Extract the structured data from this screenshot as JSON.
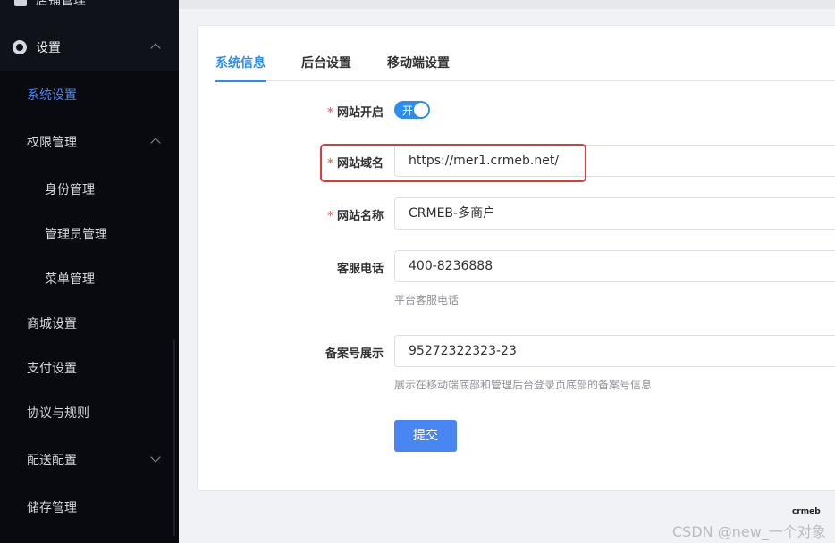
{
  "sidebar": {
    "top_item": "店铺管理",
    "parent": {
      "label": "设置",
      "icon": "gear-icon"
    },
    "items": [
      {
        "label": "系统设置",
        "active": true,
        "level": 2
      },
      {
        "label": "权限管理",
        "active": false,
        "level": 2,
        "expandable": "up"
      },
      {
        "label": "身份管理",
        "active": false,
        "level": 3
      },
      {
        "label": "管理员管理",
        "active": false,
        "level": 3
      },
      {
        "label": "菜单管理",
        "active": false,
        "level": 3
      },
      {
        "label": "商城设置",
        "active": false,
        "level": 2
      },
      {
        "label": "支付设置",
        "active": false,
        "level": 2
      },
      {
        "label": "协议与规则",
        "active": false,
        "level": 2
      },
      {
        "label": "配送配置",
        "active": false,
        "level": 2,
        "expandable": "down"
      },
      {
        "label": "储存管理",
        "active": false,
        "level": 2
      }
    ]
  },
  "tabs": [
    {
      "label": "系统信息",
      "active": true
    },
    {
      "label": "后台设置",
      "active": false
    },
    {
      "label": "移动端设置",
      "active": false
    }
  ],
  "form": {
    "site_open": {
      "label": "网站开启",
      "required": true,
      "switch_text": "开",
      "value": true
    },
    "site_domain": {
      "label": "网站域名",
      "required": true,
      "value": "https://mer1.crmeb.net/"
    },
    "site_name": {
      "label": "网站名称",
      "required": true,
      "value": "CRMEB-多商户"
    },
    "service_phone": {
      "label": "客服电话",
      "required": false,
      "value": "400-8236888",
      "help": "平台客服电话"
    },
    "icp": {
      "label": "备案号展示",
      "required": false,
      "value": "95272322323-23",
      "help": "展示在移动端底部和管理后台登录页底部的备案号信息"
    },
    "submit_label": "提交"
  },
  "watermark": {
    "logo": "crmeb",
    "text": "CSDN @new_一个对象"
  },
  "colors": {
    "accent": "#2d8cf0",
    "sidebar_bg": "#0f1219",
    "highlight": "#e03b3b",
    "button": "#4a85f4"
  }
}
